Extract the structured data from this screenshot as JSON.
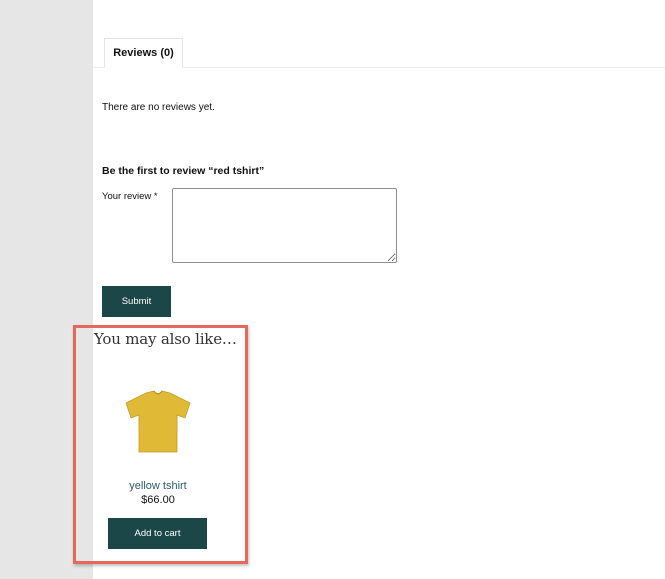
{
  "tabs": [
    {
      "label": "Reviews (0)"
    }
  ],
  "reviews": {
    "empty_message": "There are no reviews yet.",
    "form_heading": "Be the first to review “red tshirt”",
    "review_label": "Your review *",
    "review_value": "",
    "submit_label": "Submit"
  },
  "related": {
    "heading": "You may also like…",
    "products": [
      {
        "name": "yellow tshirt",
        "price": "$66.00",
        "image_icon": "yellow-tshirt-image",
        "add_to_cart_label": "Add to cart"
      }
    ]
  },
  "colors": {
    "accent": "#1c4749",
    "highlight": "#e8675d",
    "gutter": "#e6e6e6",
    "shirt": "#e0b936"
  }
}
